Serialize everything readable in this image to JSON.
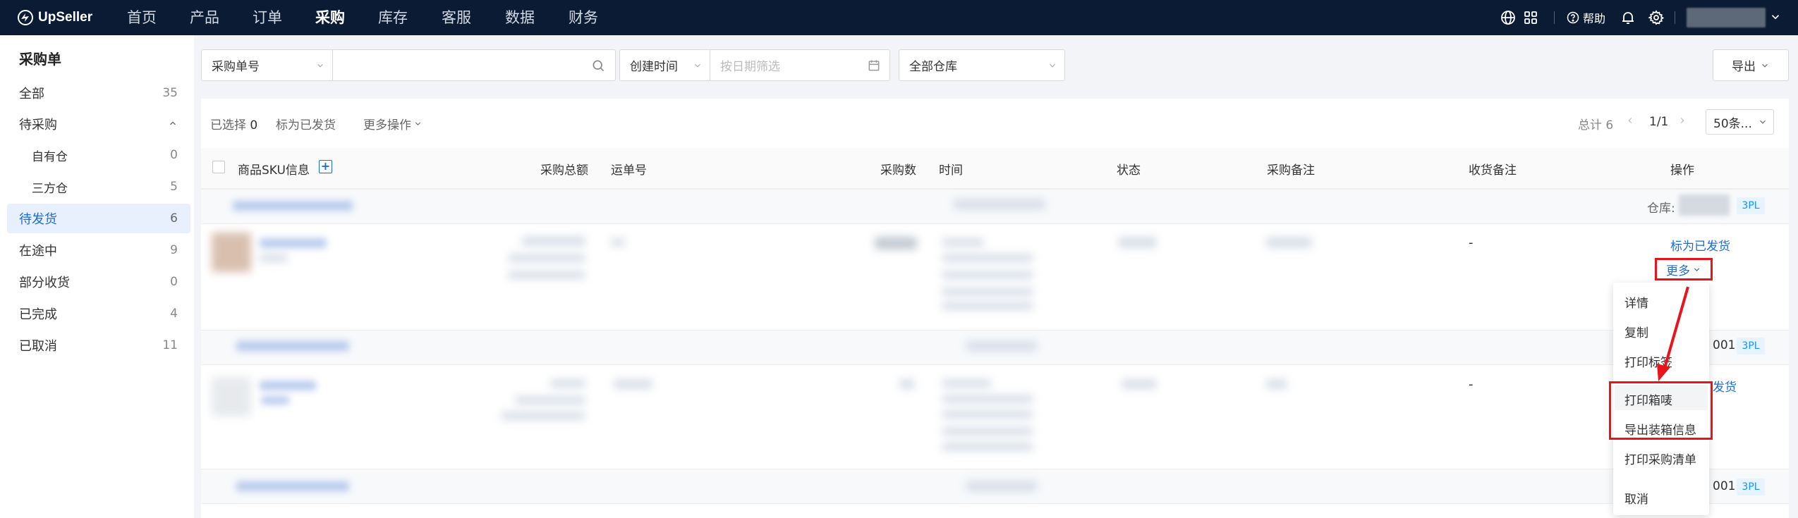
{
  "app": {
    "logo_text": "UpSeller"
  },
  "nav": {
    "items": [
      "首页",
      "产品",
      "订单",
      "采购",
      "库存",
      "客服",
      "数据",
      "财务"
    ],
    "active": "采购"
  },
  "header_right": {
    "help_label": "帮助"
  },
  "sidebar": {
    "title": "采购单",
    "items": [
      {
        "label": "全部",
        "count": "35"
      },
      {
        "label": "待采购",
        "count": ""
      },
      {
        "label": "自有仓",
        "count": "0"
      },
      {
        "label": "三方仓",
        "count": "5"
      },
      {
        "label": "待发货",
        "count": "6"
      },
      {
        "label": "在途中",
        "count": "9"
      },
      {
        "label": "部分收货",
        "count": "0"
      },
      {
        "label": "已完成",
        "count": "4"
      },
      {
        "label": "已取消",
        "count": "11"
      }
    ]
  },
  "filters": {
    "search_type": "采购单号",
    "search_value": "",
    "date_type": "创建时间",
    "date_placeholder": "按日期筛选",
    "warehouse": "全部仓库",
    "export_label": "导出"
  },
  "toolbar": {
    "selected_label": "已选择",
    "selected_count": "0",
    "mark_shipped": "标为已发货",
    "more_ops": "更多操作",
    "total": "总计 6",
    "page": "1/1",
    "page_size": "50条..."
  },
  "table": {
    "columns": [
      "商品SKU信息",
      "采购总额",
      "运单号",
      "采购数",
      "时间",
      "状态",
      "采购备注",
      "收货备注",
      "操作"
    ]
  },
  "rows": {
    "warehouse_label": "仓库:",
    "tag": "3PL",
    "dash": "-",
    "action_mark": "标为已发货",
    "action_more": "更多",
    "partial_001": "001"
  },
  "dropdown": {
    "items": [
      "详情",
      "复制",
      "打印标签",
      "打印箱唛",
      "导出装箱信息",
      "打印采购清单",
      "取消"
    ]
  },
  "colors": {
    "topbar": "#0b1b33",
    "accent": "#1a6bdb",
    "highlight": "#e8141b"
  }
}
